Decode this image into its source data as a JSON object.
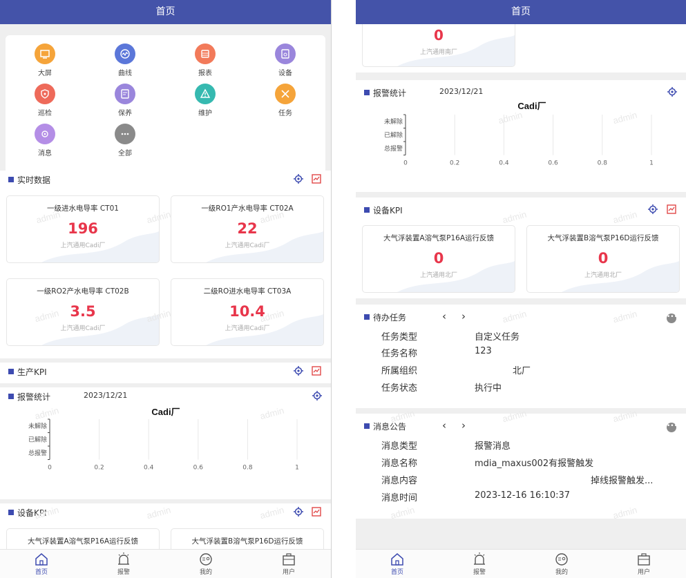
{
  "screen1": {
    "header": {
      "title": "首页"
    },
    "grid": [
      {
        "label": "大屏",
        "icon": "screen-icon",
        "color": "#f5a43a"
      },
      {
        "label": "曲线",
        "icon": "curve-icon",
        "color": "#5b77d9"
      },
      {
        "label": "报表",
        "icon": "report-icon",
        "color": "#f27a5a"
      },
      {
        "label": "设备",
        "icon": "device-icon",
        "color": "#9a86dc"
      },
      {
        "label": "巡检",
        "icon": "inspection-icon",
        "color": "#ee6a5a"
      },
      {
        "label": "保养",
        "icon": "maintenance-icon",
        "color": "#9a86dc"
      },
      {
        "label": "维护",
        "icon": "repair-icon",
        "color": "#36b9b0"
      },
      {
        "label": "任务",
        "icon": "task-icon",
        "color": "#f5a43a"
      },
      {
        "label": "消息",
        "icon": "message-icon",
        "color": "#b48ee6"
      },
      {
        "label": "全部",
        "icon": "more-icon",
        "color": "#8a8a8a"
      }
    ],
    "realtime": {
      "title": "实时数据",
      "cards": [
        {
          "name": "一级进水电导率 CT01",
          "value": "196",
          "source": "上汽通用Cadi厂"
        },
        {
          "name": "一级RO1产水电导率 CT02A",
          "value": "22",
          "source": "上汽通用Cadi厂"
        },
        {
          "name": "一级RO2产水电导率 CT02B",
          "value": "3.5",
          "source": "上汽通用Cadi厂"
        },
        {
          "name": "二级RO进水电导率 CT03A",
          "value": "10.4",
          "source": "上汽通用Cadi厂"
        }
      ]
    },
    "production_kpi": {
      "title": "生产KPI"
    },
    "alarm": {
      "title": "报警统计",
      "date": "2023/12/21",
      "chart_title": "Cadi厂"
    },
    "device_kpi": {
      "title": "设备KPI",
      "cards": [
        {
          "name": "大气浮装置A溶气泵P16A运行反馈"
        },
        {
          "name": "大气浮装置B溶气泵P16D运行反馈"
        }
      ]
    },
    "watermark": "admin"
  },
  "screen2": {
    "header": {
      "title": "首页"
    },
    "top_card": {
      "value": "0",
      "source": "上汽通用南厂"
    },
    "alarm": {
      "title": "报警统计",
      "date": "2023/12/21",
      "chart_title": "Cadi厂"
    },
    "device_kpi": {
      "title": "设备KPI",
      "cards": [
        {
          "name": "大气浮装置A溶气泵P16A运行反馈",
          "value": "0",
          "source": "上汽通用北厂"
        },
        {
          "name": "大气浮装置B溶气泵P16D运行反馈",
          "value": "0",
          "source": "上汽通用北厂"
        }
      ]
    },
    "todo": {
      "title": "待办任务",
      "rows": [
        {
          "label": "任务类型",
          "value": "自定义任务"
        },
        {
          "label": "任务名称",
          "value": "123"
        },
        {
          "label": "所属组织",
          "value": "北厂"
        },
        {
          "label": "任务状态",
          "value": "执行中"
        }
      ]
    },
    "notice": {
      "title": "消息公告",
      "rows": [
        {
          "label": "消息类型",
          "value": "报警消息"
        },
        {
          "label": "消息名称",
          "value": "mdia_maxus002有报警触发"
        },
        {
          "label": "消息内容",
          "value": "掉线报警触发..."
        },
        {
          "label": "消息时间",
          "value": "2023-12-16 16:10:37"
        }
      ]
    }
  },
  "tabbar": [
    {
      "label": "首页",
      "icon": "home-icon"
    },
    {
      "label": "报警",
      "icon": "alarm-icon"
    },
    {
      "label": "我的",
      "icon": "profile-icon"
    },
    {
      "label": "用户",
      "icon": "user-icon"
    }
  ],
  "chart_data": {
    "type": "bar",
    "orientation": "horizontal",
    "title": "Cadi厂",
    "categories": [
      "未解除",
      "已解除",
      "总报警"
    ],
    "values": [
      0,
      0,
      0
    ],
    "xlim": [
      0,
      1
    ],
    "xticks": [
      "0",
      "0.2",
      "0.4",
      "0.6",
      "0.8",
      "1"
    ],
    "grid": true
  },
  "colors": {
    "header": "#4453a9",
    "accent": "#3d4bb0",
    "value_red": "#e8364b",
    "export_red": "#e04848"
  }
}
